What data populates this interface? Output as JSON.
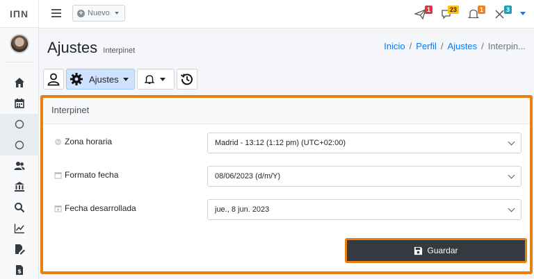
{
  "app": {
    "logo_text": "IΠN"
  },
  "topbar": {
    "nuevo_label": "Nuevo",
    "badges": [
      "1",
      "23",
      "1",
      "3"
    ]
  },
  "header": {
    "title": "Ajustes",
    "subtitle": "Interpinet",
    "breadcrumb": [
      "Inicio",
      "Perfil",
      "Ajustes",
      "Interpin..."
    ]
  },
  "toolbar": {
    "ajustes_label": "Ajustes"
  },
  "card": {
    "title": "Interpinet",
    "fields": [
      {
        "label": "Zona horaria",
        "value": "Madrid - 13:12 (1:12 pm) (UTC+02:00)"
      },
      {
        "label": "Formato fecha",
        "value": "08/06/2023 (d/m/Y)"
      },
      {
        "label": "Fecha desarrollada",
        "value": "jue., 8 jun. 2023"
      }
    ],
    "save_label": "Guardar"
  },
  "colors": {
    "accent": "#e8800f",
    "primary": "#007bff",
    "dark": "#343a40"
  }
}
